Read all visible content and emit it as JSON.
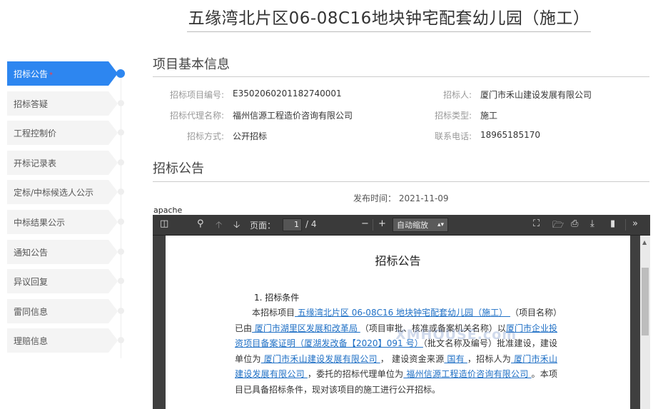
{
  "page_title": "五缘湾北片区06-08C16地块钟宅配套幼儿园（施工）",
  "sidebar": {
    "items": [
      {
        "label": "招标公告",
        "required_mark": "*",
        "active": true
      },
      {
        "label": "招标答疑",
        "required_mark": "",
        "active": false
      },
      {
        "label": "工程控制价",
        "required_mark": "",
        "active": false
      },
      {
        "label": "开标记录表",
        "required_mark": "",
        "active": false
      },
      {
        "label": "定标/中标候选人公示",
        "required_mark": "",
        "active": false
      },
      {
        "label": "中标结果公示",
        "required_mark": "",
        "active": false
      },
      {
        "label": "通知公告",
        "required_mark": "",
        "active": false
      },
      {
        "label": "异议回复",
        "required_mark": "",
        "active": false
      },
      {
        "label": "雷同信息",
        "required_mark": "",
        "active": false
      },
      {
        "label": "理赔信息",
        "required_mark": "",
        "active": false
      }
    ]
  },
  "project_info": {
    "heading": "项目基本信息",
    "fields": {
      "project_no_label": "招标项目编号:",
      "project_no": "E3502060201182740001",
      "tenderer_label": "招标人:",
      "tenderer": "厦门市禾山建设发展有限公司",
      "agent_label": "招标代理名称:",
      "agent": "福州信源工程造价咨询有限公司",
      "type_label": "招标类型:",
      "type": "施工",
      "method_label": "招标方式:",
      "method": "公开招标",
      "phone_label": "联系电话:",
      "phone": "18965185170"
    }
  },
  "announcement": {
    "heading": "招标公告",
    "publish_time": "发布时间： 2021-11-09",
    "apache_label": "apache"
  },
  "viewer": {
    "page_label": "页面：",
    "page_current": "1",
    "page_total": "/ 4",
    "zoom": "自动缩放",
    "doc_title": "招标公告",
    "section1": "1. 招标条件",
    "watermark": "XMHOUSE.com",
    "body": {
      "t1": "本招标项目",
      "l1": " 五缘湾北片区 06-08C16 地块钟宅配套幼儿园（施工） ",
      "t2": "（项目名称）已由",
      "l2": " 厦门市湖里区发展和改革局 ",
      "t3": "（项目审批、核准或备案机关名称）以",
      "l3": "厦门市企业投资项目备案证明（厦湖发改备【2020】091 号）",
      "t4": "（批文名称及编号）批准建设，建设单位为",
      "l4": " 厦门市禾山建设发展有限公司 ",
      "t5": "， 建设资金来源",
      "l5": " 国有 ",
      "t6": "，招标人为",
      "l6": " 厦门市禾山建设发展有限公司 ",
      "t7": "，委托的招标代理单位为",
      "l7": " 福州信源工程造价咨询有限公司 ",
      "t8": "。本项目已具备招标条件，现对该项目的施工进行公开招标。"
    }
  },
  "colors": {
    "accent": "#2d86f0",
    "link": "#1e6fc5",
    "toolbar": "#3a3a3a"
  }
}
